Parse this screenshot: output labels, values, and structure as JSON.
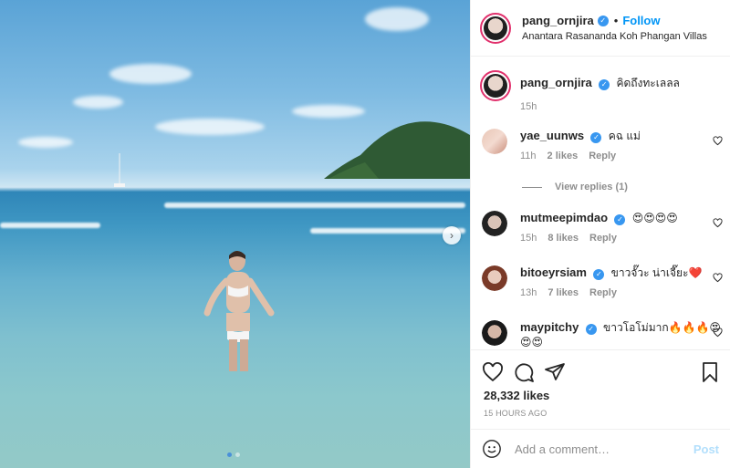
{
  "post": {
    "username": "pang_ornjira",
    "separator": "•",
    "follow_label": "Follow",
    "location": "Anantara Rasananda Koh Phangan Villas",
    "caption": "คิดถึงทะเลลล",
    "caption_time": "15h",
    "likes": "28,332 likes",
    "time_ago": "15 HOURS AGO",
    "add_comment_placeholder": "Add a comment…",
    "post_label": "Post",
    "carousel_index": 0,
    "carousel_count": 2
  },
  "comments": [
    {
      "user": "yae_uunws",
      "text": "คฉ แม่",
      "time": "11h",
      "likes": "2 likes",
      "reply": "Reply"
    },
    {
      "user": "mutmeepimdao",
      "text": "😍😍😍😍",
      "time": "15h",
      "likes": "8 likes",
      "reply": "Reply"
    },
    {
      "user": "bitoeyrsiam",
      "text": "ขาวจั๊วะ น่าเจี๊ยะ❤️",
      "time": "13h",
      "likes": "7 likes",
      "reply": "Reply"
    },
    {
      "user": "maypitchy",
      "text": "ขาวโอโม่มาก🔥🔥🔥😍",
      "text2": "😍😍",
      "time": "",
      "likes": "",
      "reply": ""
    }
  ],
  "view_replies": "View replies (1)",
  "colors": {
    "accent": "#0095f6",
    "verified": "#3897f0",
    "muted": "#8e8e8e"
  }
}
